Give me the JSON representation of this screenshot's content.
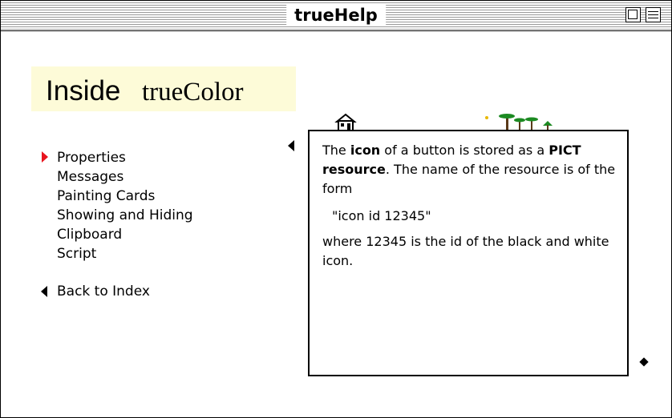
{
  "window": {
    "title": "trueHelp",
    "controls": [
      "zoom-box",
      "collapse-box"
    ]
  },
  "header": {
    "part1": "Inside",
    "part2": "trueColor",
    "background": "#fdfbd8"
  },
  "nav": {
    "items": [
      {
        "label": "Properties",
        "selected": true
      },
      {
        "label": "Messages"
      },
      {
        "label": "Painting Cards"
      },
      {
        "label": "Showing and Hiding"
      },
      {
        "label": "Clipboard"
      },
      {
        "label": "Script"
      }
    ],
    "back_label": "Back to Index",
    "marker_color": "#e8141e"
  },
  "panel": {
    "p1_a": "The ",
    "p1_icon": "icon",
    "p1_b": " of a button is stored as a ",
    "p1_pict": "PICT",
    "p1_resource": "resource",
    "p1_c": ". The name of the resource is of the form",
    "code": "\"icon id 12345\"",
    "p2": "where 12345 is the id of the black and white icon."
  },
  "icons": [
    "prev-arrow-icon",
    "house-icon",
    "trees-icon",
    "diamond-icon"
  ]
}
